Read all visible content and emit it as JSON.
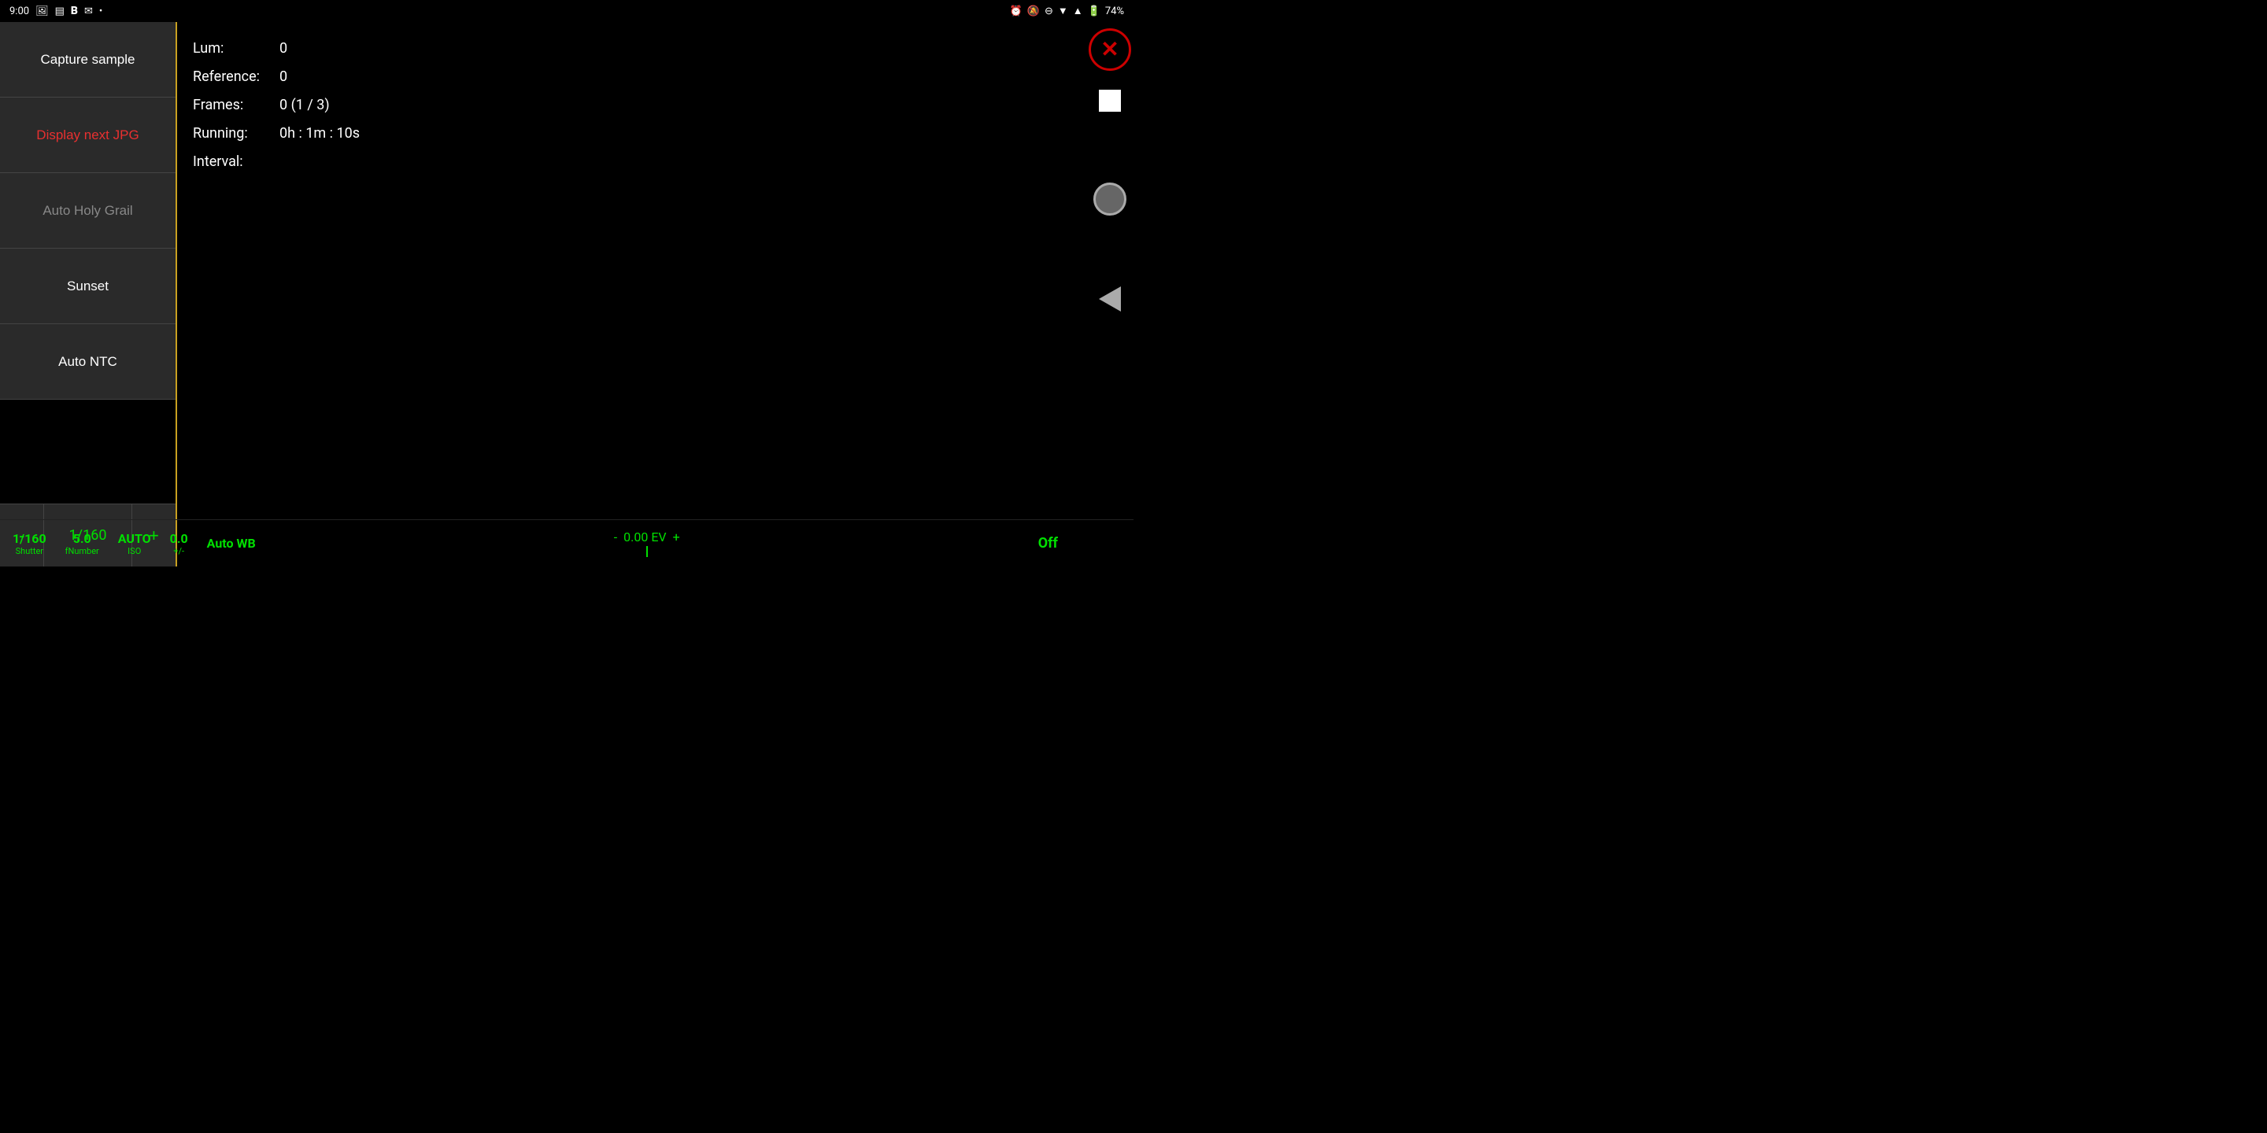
{
  "statusBar": {
    "time": "9:00",
    "battery": "74%",
    "icons": [
      "photo",
      "list",
      "bold",
      "mail",
      "dot",
      "alarm",
      "bell-off",
      "minus-circle",
      "wifi",
      "signal",
      "battery"
    ]
  },
  "leftPanel": {
    "buttons": [
      {
        "id": "capture-sample",
        "label": "Capture sample",
        "style": "normal"
      },
      {
        "id": "display-next-jpg",
        "label": "Display next JPG",
        "style": "red"
      },
      {
        "id": "auto-holy-grail",
        "label": "Auto Holy Grail",
        "style": "dim"
      },
      {
        "id": "sunset",
        "label": "Sunset",
        "style": "normal"
      },
      {
        "id": "auto-ntc",
        "label": "Auto NTC",
        "style": "normal"
      }
    ],
    "shutterRow": {
      "minus": "-",
      "value": "1/160",
      "plus": "+"
    }
  },
  "infoPanel": {
    "rows": [
      {
        "label": "Lum:",
        "value": "0"
      },
      {
        "label": "Reference:",
        "value": "0"
      },
      {
        "label": "Frames:",
        "value": "0 (1 / 3)"
      },
      {
        "label": "Running:",
        "value": "0h : 1m : 10s"
      },
      {
        "label": "Interval:",
        "value": ""
      }
    ]
  },
  "bottomBar": {
    "shutter": {
      "value": "1/160",
      "label": "Shutter"
    },
    "fnumber": {
      "value": "5.0",
      "label": "fNumber"
    },
    "iso": {
      "value": "AUTO",
      "label": "ISO"
    },
    "plusMinus": {
      "value": "0.0",
      "label": "+/-"
    },
    "autoWB": "Auto WB",
    "ev": {
      "minus": "-",
      "value": "0.00 EV",
      "plus": "+"
    },
    "off": "Off"
  }
}
